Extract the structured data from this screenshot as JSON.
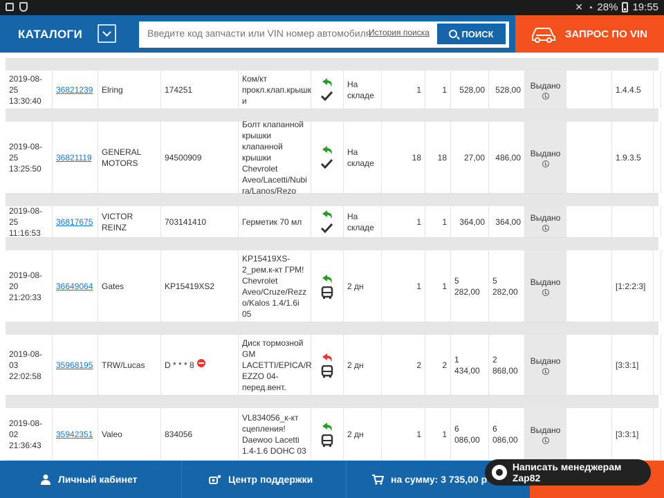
{
  "statusbar": {
    "battery": "28%",
    "time": "19:55"
  },
  "header": {
    "catalog_label": "КАТАЛОГИ",
    "search_placeholder": "Введите код запчасти или VIN номер автомобиля",
    "history_link": "История поиска",
    "search_button": "ПОИСК",
    "vin_button": "ЗАПРОС ПО VIN"
  },
  "rows": [
    {
      "date": "2019-08-25",
      "time": "13:30:40",
      "order": "36821239",
      "brand": "Elring",
      "article": "174251",
      "desc": [
        "Ком/кт",
        "прокл.клап.крышк",
        "и"
      ],
      "return_type": "green",
      "delivery": "check",
      "availability": [
        "На",
        "складе"
      ],
      "ordered": "1",
      "qty": "1",
      "price": "528,00",
      "sum": "528,00",
      "status": "Выдано",
      "code": "1.4.4.5"
    },
    {
      "date": "2019-08-25",
      "time": "13:25:50",
      "order": "36821119",
      "brand": "GENERAL MOTORS",
      "article": "94500909",
      "desc": [
        "Болт клапанной",
        "крышки",
        "клапанной",
        "крышки Chevrolet",
        "Aveo/Lacetti/Nubi",
        "ra/Lanos/Rezo"
      ],
      "return_type": "green",
      "delivery": "check",
      "availability": [
        "На",
        "складе"
      ],
      "ordered": "18",
      "qty": "18",
      "price": "27,00",
      "sum": "486,00",
      "status": "Выдано",
      "code": "1.9.3.5"
    },
    {
      "date": "2019-08-25",
      "time": "11:16:53",
      "order": "36817675",
      "brand": "VICTOR REINZ",
      "article": "703141410",
      "desc": [
        "Герметик 70 мл"
      ],
      "return_type": "green",
      "delivery": "check",
      "availability": [
        "На",
        "складе"
      ],
      "ordered": "1",
      "qty": "1",
      "price": "364,00",
      "sum": "364,00",
      "status": "Выдано",
      "code": ""
    },
    {
      "date": "2019-08-20",
      "time": "21:20:33",
      "order": "36649064",
      "brand": "Gates",
      "article": "KP15419XS2",
      "desc": [
        "KP15419XS-",
        "2_рем.к-кт ГРМ!",
        "Chevrolet",
        "Aveo/Cruze/Rezz",
        "o/Kalos 1.4/1.6i",
        "05"
      ],
      "return_type": "green",
      "delivery": "bus",
      "availability": [
        "2 дн"
      ],
      "ordered": "1",
      "qty": "1",
      "price": "5 282,00",
      "sum": "5 282,00",
      "status": "Выдано",
      "code": "[1:2:2:3]"
    },
    {
      "date": "2019-08-03",
      "time": "22:02:58",
      "order": "35968195",
      "brand": "TRW/Lucas",
      "article": "D * * * 8",
      "desc": [
        "Диск тормозной",
        "GM",
        "LACETTI/EPICA/R",
        "EZZO 04-",
        "перед.вент."
      ],
      "return_type": "red",
      "delivery": "bus",
      "availability": [
        "2 дн"
      ],
      "ordered": "2",
      "qty": "2",
      "price": "1 434,00",
      "sum": "2 868,00",
      "status": "Выдано",
      "code": "[3:3:1]"
    },
    {
      "date": "2019-08-02",
      "time": "21:36:43",
      "order": "35942351",
      "brand": "Valeo",
      "article": "834056",
      "desc": [
        "VL834056_к-кт",
        "сцепления!",
        "Daewoo Lacetti",
        "1.4-1.6 DOHC 03"
      ],
      "return_type": "green",
      "delivery": "bus",
      "availability": [
        "2 дн"
      ],
      "ordered": "1",
      "qty": "1",
      "price": "6 086,00",
      "sum": "6 086,00",
      "status": "Выдано",
      "code": "[3:3:1]"
    }
  ],
  "footer": {
    "cabinet": "Личный кабинет",
    "support": "Центр поддержки",
    "cart": "на сумму: 3 735,00 р"
  },
  "chat": {
    "label": "Написать менеджерам Zap82"
  },
  "colors": {
    "header": "#1565a8",
    "accent": "#f4511e",
    "return_ok": "#2e9a2e",
    "return_bad": "#e53935"
  }
}
